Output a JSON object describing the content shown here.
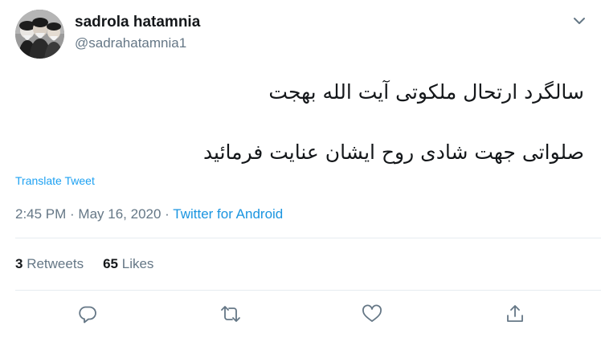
{
  "user": {
    "display_name": "sadrola hatamnia",
    "handle": "@sadrahatamnia1",
    "avatar_icon": "avatar-portrait"
  },
  "tweet": {
    "line1": "سالگرد ارتحال ملکوتی آیت الله بهجت",
    "line2": "صلواتی جهت شادی روح ایشان عنایت فرمائید",
    "translate_label": "Translate Tweet",
    "time": "2:45 PM",
    "separator1": " · ",
    "date": "May 16, 2020",
    "separator2": " · ",
    "source": "Twitter for Android"
  },
  "stats": {
    "retweets_count": "3",
    "retweets_label": "Retweets",
    "likes_count": "65",
    "likes_label": "Likes"
  },
  "actions": {
    "reply_icon": "reply-icon",
    "retweet_icon": "retweet-icon",
    "like_icon": "heart-icon",
    "share_icon": "share-icon"
  },
  "colors": {
    "text": "#14171a",
    "secondary": "#657786",
    "link": "#1da1f2",
    "divider": "#e6ecf0"
  }
}
